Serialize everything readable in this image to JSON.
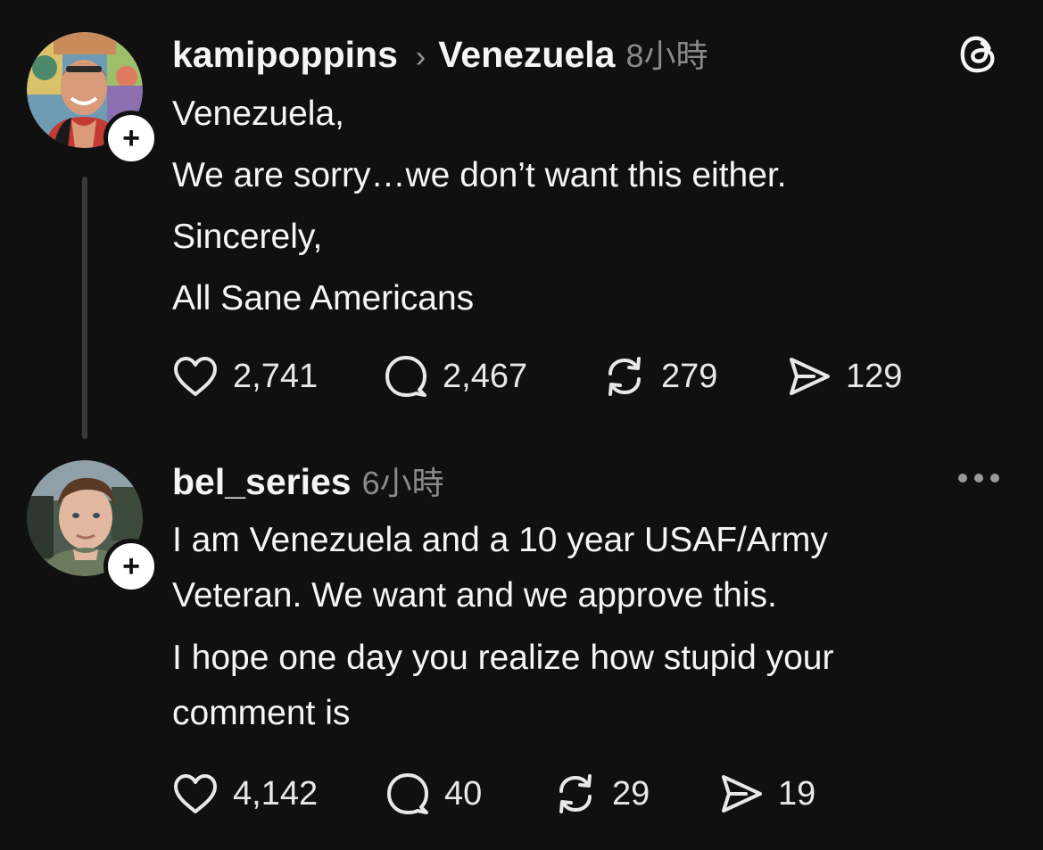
{
  "posts": [
    {
      "username": "kamipoppins",
      "community": "Venezuela",
      "time": "8小時",
      "follow_symbol": "+",
      "lines": [
        "Venezuela,",
        "We are sorry…we don’t want this either.",
        "Sincerely,",
        "All Sane Americans"
      ],
      "likes": "2,741",
      "replies": "2,467",
      "reposts": "279",
      "shares": "129",
      "avatar_colors": {
        "bg": "#7aa0b8",
        "skin": "#d99b7a",
        "shirt": "#c23a32"
      },
      "top_right_icon": "threads-logo-icon"
    },
    {
      "username": "bel_series",
      "time": "6小時",
      "follow_symbol": "+",
      "lines": [
        "I am Venezuela and a 10 year USAF/Army",
        "Veteran. We want and we approve this.",
        "I hope one day you realize how stupid your",
        "comment is"
      ],
      "likes": "4,142",
      "replies": "40",
      "reposts": "29",
      "shares": "19",
      "avatar_colors": {
        "bg": "#5f6c5c",
        "skin": "#e2b8a0",
        "hair": "#5a3a25"
      },
      "top_right_icon": "more-options-icon"
    }
  ],
  "theme": {
    "background": "#101010",
    "text": "#f3f5f7",
    "muted": "#8a8a8a",
    "thread_line": "#3a3a3a"
  }
}
